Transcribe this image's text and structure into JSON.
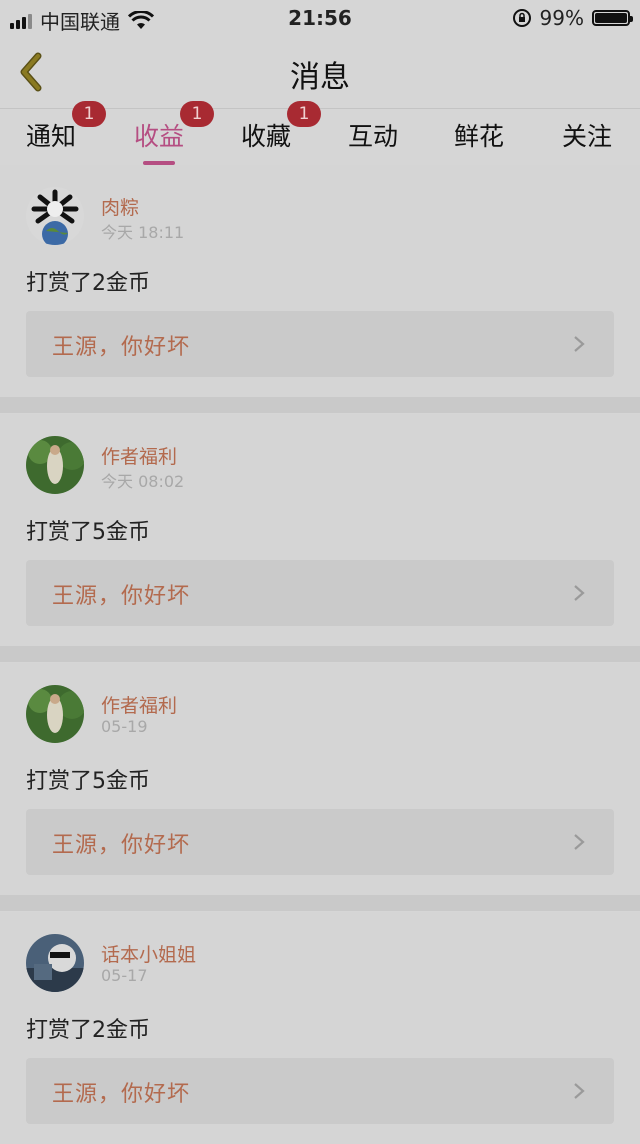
{
  "status_bar": {
    "carrier": "中国联通",
    "time": "21:56",
    "battery": "99%",
    "battery_level": 0.99,
    "signal_bars": 4,
    "signal_active": 3
  },
  "nav": {
    "title": "消息",
    "back_icon": "chevron-left-icon"
  },
  "tabs": [
    {
      "label": "通知",
      "badge": "1"
    },
    {
      "label": "收益",
      "badge": "1",
      "active": true
    },
    {
      "label": "收藏",
      "badge": "1"
    },
    {
      "label": "互动"
    },
    {
      "label": "鲜花"
    },
    {
      "label": "关注"
    }
  ],
  "feed": [
    {
      "user": "肉粽",
      "time": "今天 18:11",
      "action": "打赏了2金币",
      "quote": "王源，你好坏",
      "avatar": "avatar-ruozong"
    },
    {
      "user": "作者福利",
      "time": "今天 08:02",
      "action": "打赏了5金币",
      "quote": "王源，你好坏",
      "avatar": "avatar-author-welfare"
    },
    {
      "user": "作者福利",
      "time": "05-19",
      "action": "打赏了5金币",
      "quote": "王源，你好坏",
      "avatar": "avatar-author-welfare"
    },
    {
      "user": "话本小姐姐",
      "time": "05-17",
      "action": "打赏了2金币",
      "quote": "王源，你好坏",
      "avatar": "avatar-story-sister"
    }
  ],
  "colors": {
    "accent": "#b54e82",
    "badge": "#a82a32",
    "username": "#b36a4e",
    "back_arrow": "#8a7a22"
  }
}
